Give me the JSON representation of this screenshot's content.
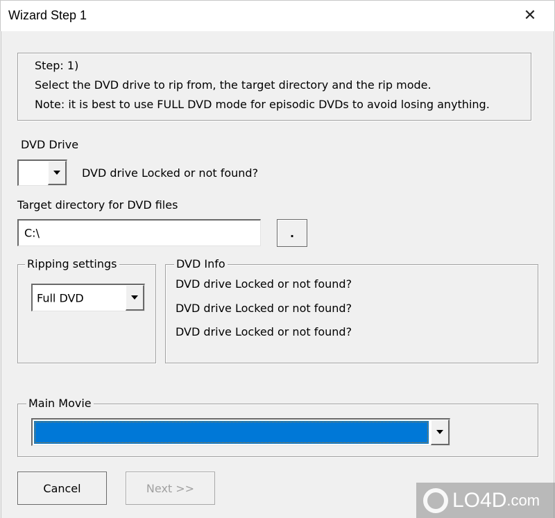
{
  "window": {
    "title": "Wizard Step 1",
    "close_icon": "close-icon"
  },
  "instructions": {
    "step": "Step: 1)",
    "line1": "Select the DVD drive to rip from, the target directory and the rip mode.",
    "line2": "Note: it is best to use FULL DVD mode for episodic DVDs to avoid losing anything."
  },
  "dvd_drive": {
    "label": "DVD Drive",
    "selected": "",
    "status": "DVD drive Locked or not found?"
  },
  "target_dir": {
    "label": "Target directory for DVD files",
    "value": "C:\\",
    "browse_label": "."
  },
  "ripping_settings": {
    "legend": "Ripping settings",
    "mode_selected": "Full DVD"
  },
  "dvd_info": {
    "legend": "DVD Info",
    "lines": [
      "DVD drive Locked or not found?",
      "DVD drive Locked or not found?",
      "DVD drive Locked or not found?"
    ]
  },
  "main_movie": {
    "legend": "Main Movie",
    "selected": "",
    "highlight_color": "#0078d7"
  },
  "buttons": {
    "cancel": "Cancel",
    "next": "Next >>"
  },
  "watermark": {
    "text": "LO4D",
    "suffix": ".com"
  }
}
